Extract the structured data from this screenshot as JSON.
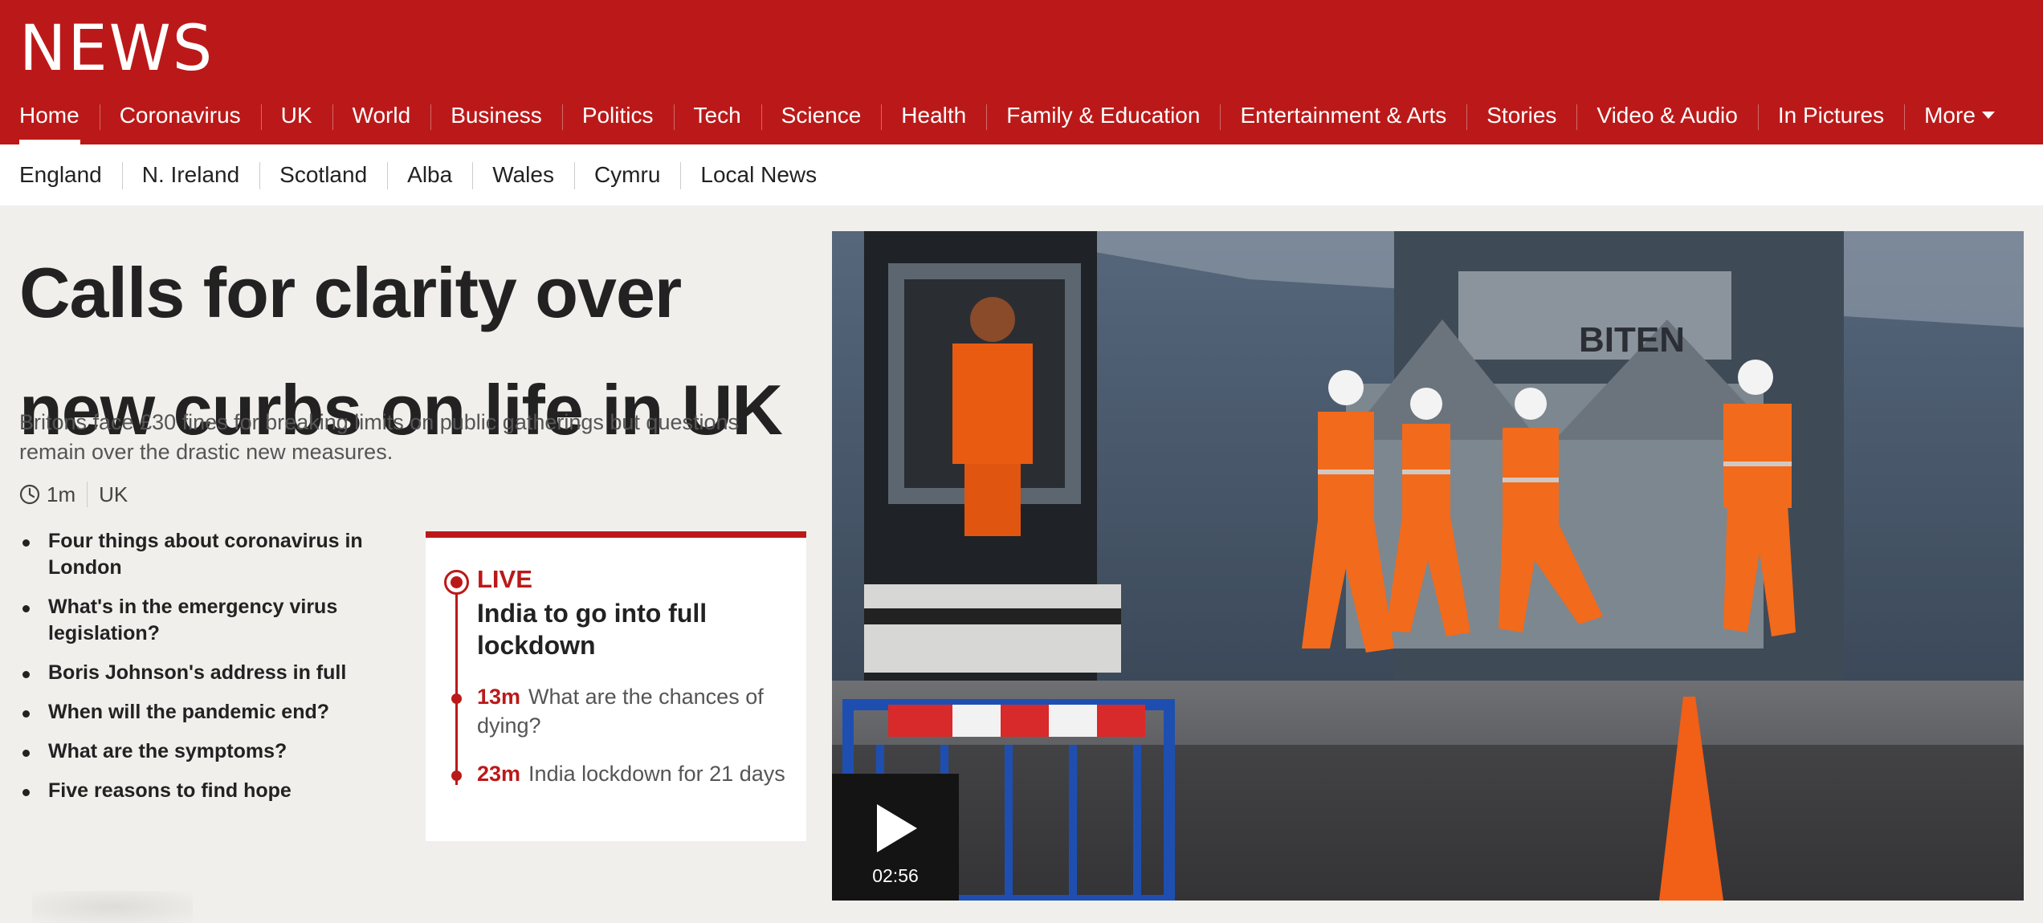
{
  "brand": {
    "logo_text": "NEWS",
    "color": "#bb1919"
  },
  "primary_nav": [
    {
      "label": "Home",
      "active": true
    },
    {
      "label": "Coronavirus"
    },
    {
      "label": "UK"
    },
    {
      "label": "World"
    },
    {
      "label": "Business"
    },
    {
      "label": "Politics"
    },
    {
      "label": "Tech"
    },
    {
      "label": "Science"
    },
    {
      "label": "Health"
    },
    {
      "label": "Family & Education"
    },
    {
      "label": "Entertainment & Arts"
    },
    {
      "label": "Stories"
    },
    {
      "label": "Video & Audio"
    },
    {
      "label": "In Pictures"
    },
    {
      "label": "More",
      "icon": "caret-down-icon"
    }
  ],
  "secondary_nav": [
    "England",
    "N. Ireland",
    "Scotland",
    "Alba",
    "Wales",
    "Cymru",
    "Local News"
  ],
  "lead": {
    "headline": "Calls for clarity over new curbs on life in UK",
    "summary": "Britons face £30 fines for breaking limits on public gatherings but questions remain over the drastic new measures.",
    "time": "1m",
    "section": "UK",
    "time_icon": "clock-icon"
  },
  "related_links": [
    "Four things about coronavirus in London",
    "What's in the emergency virus legislation?",
    "Boris Johnson's address in full",
    "When will the pandemic end?",
    "What are the symptoms?",
    "Five reasons to find hope"
  ],
  "live": {
    "label": "LIVE",
    "title": "India to go into full lockdown",
    "entries": [
      {
        "time": "13m",
        "text": "What are the chances of dying?"
      },
      {
        "time": "23m",
        "text": "India lockdown for 21 days"
      }
    ]
  },
  "media": {
    "duration": "02:56",
    "play_icon": "play-icon",
    "vehicle_lettering": "BITEN"
  }
}
